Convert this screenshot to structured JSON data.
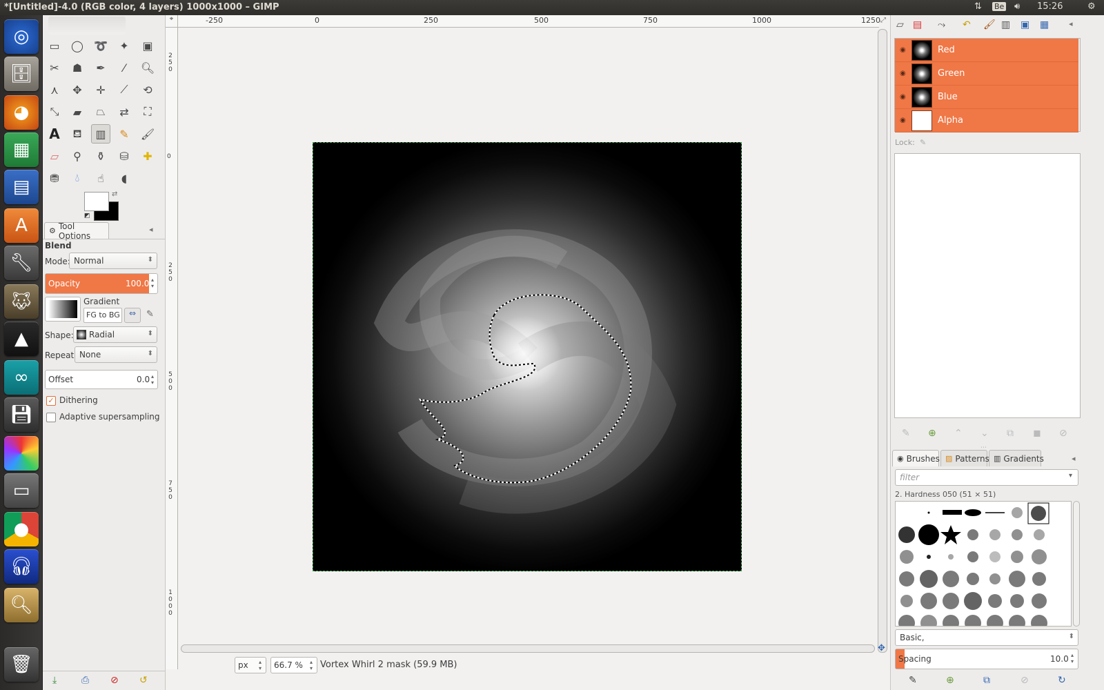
{
  "window": {
    "title": "*[Untitled]-4.0 (RGB color, 4 layers) 1000x1000 – GIMP"
  },
  "tray": {
    "kbd": "Be",
    "time": "15:26"
  },
  "launcher": {
    "icons": [
      "ubuntu-dash-icon",
      "files-icon",
      "firefox-icon",
      "calc-icon",
      "writer-icon",
      "software-center-icon",
      "settings-icon",
      "gimp-icon",
      "inkscape-icon",
      "arduino-icon",
      "save-icon",
      "shotwell-icon",
      "scanner-icon",
      "chrome-icon",
      "audacity-icon",
      "viewer-icon",
      "trash-icon"
    ]
  },
  "tool_options": {
    "tab_label": "Tool Options",
    "tool_name": "Blend",
    "mode_label": "Mode:",
    "mode_value": "Normal",
    "opacity_label": "Opacity",
    "opacity_value": "100.0",
    "gradient_label": "Gradient",
    "gradient_value": "FG to BG (",
    "shape_label": "Shape:",
    "shape_value": "Radial",
    "repeat_label": "Repeat:",
    "repeat_value": "None",
    "offset_label": "Offset",
    "offset_value": "0.0",
    "dithering_label": "Dithering",
    "dithering_checked": true,
    "adaptive_label": "Adaptive supersampling",
    "adaptive_checked": false
  },
  "ruler": {
    "h_ticks": [
      "-250",
      "0",
      "250",
      "500",
      "750",
      "1000",
      "1250"
    ],
    "v_ticks": [
      "250",
      "0",
      "250",
      "500",
      "750",
      "1000"
    ]
  },
  "status": {
    "unit": "px",
    "zoom": "66.7 %",
    "info": "Vortex Whirl 2 mask (59.9 MB)"
  },
  "channels": {
    "items": [
      {
        "name": "Red"
      },
      {
        "name": "Green"
      },
      {
        "name": "Blue"
      },
      {
        "name": "Alpha"
      }
    ],
    "lock_label": "Lock:"
  },
  "brushes": {
    "tabs": [
      "Brushes",
      "Patterns",
      "Gradients"
    ],
    "filter_placeholder": "filter",
    "selected_brush": "2. Hardness 050 (51 × 51)",
    "preset": "Basic,",
    "spacing_label": "Spacing",
    "spacing_value": "10.0"
  },
  "colors": {
    "accent": "#f07746",
    "titlebar": "#3c3b37"
  }
}
